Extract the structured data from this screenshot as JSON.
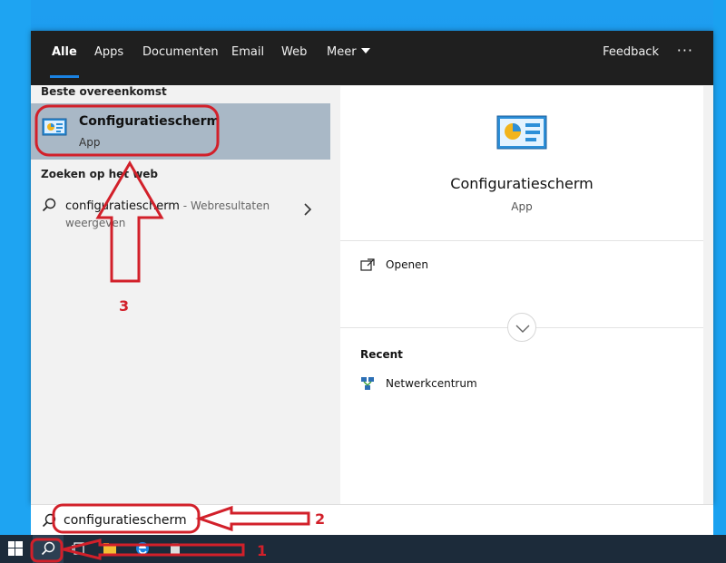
{
  "tabs": [
    {
      "label": "Alle",
      "active": true
    },
    {
      "label": "Apps"
    },
    {
      "label": "Documenten"
    },
    {
      "label": "Email"
    },
    {
      "label": "Web"
    },
    {
      "label": "Meer"
    }
  ],
  "header": {
    "feedback": "Feedback",
    "more": "···"
  },
  "left": {
    "best_heading": "Beste overeenkomst",
    "best": {
      "title": "Configuratiescherm",
      "subtitle": "App"
    },
    "web_heading": "Zoeken op het web",
    "web": {
      "query": "configuratiescherm",
      "hint": " - Webresultaten weergeven"
    }
  },
  "detail": {
    "name": "Configuratiescherm",
    "type": "App",
    "open_label": "Openen",
    "recent_heading": "Recent",
    "recent_item": "Netwerkcentrum"
  },
  "search": {
    "value": "configuratiescherm"
  },
  "annotations": {
    "n1": "1",
    "n2": "2",
    "n3": "3",
    "color": "#d2202a"
  },
  "colors": {
    "accent": "#1a82e2",
    "selected": "#a9b8c6",
    "topbar": "#1f1f1f",
    "taskbar": "#1c2b3a"
  }
}
